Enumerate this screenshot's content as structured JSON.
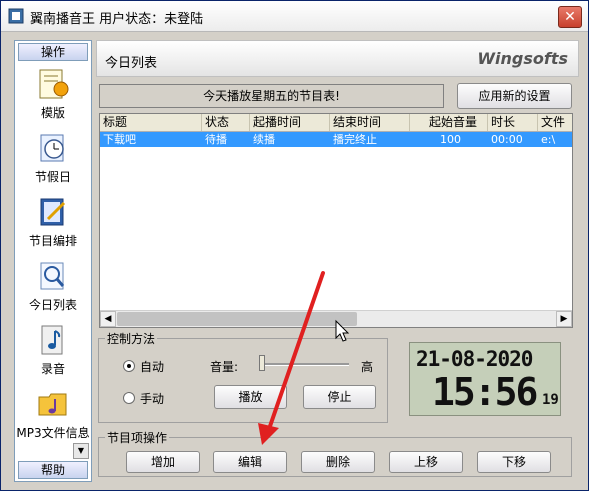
{
  "window": {
    "title": "翼南播音王  用户状态：未登陆",
    "close_glyph": "✕"
  },
  "sidebar": {
    "header": "操作",
    "items": [
      {
        "label": "模版",
        "icon": "template-icon"
      },
      {
        "label": "节假日",
        "icon": "clock-icon"
      },
      {
        "label": "节目编排",
        "icon": "schedule-edit-icon"
      },
      {
        "label": "今日列表",
        "icon": "today-list-icon"
      },
      {
        "label": "录音",
        "icon": "music-note-icon"
      },
      {
        "label": "MP3文件信息",
        "icon": "folder-music-icon"
      }
    ],
    "footer": "帮助"
  },
  "header": {
    "title": "今日列表",
    "brand": "Wingsofts"
  },
  "notice": "今天播放星期五的节目表!",
  "apply_button": "应用新的设置",
  "table": {
    "columns": [
      "标题",
      "状态",
      "起播时间",
      "结束时间",
      "起始音量",
      "时长",
      "文件"
    ],
    "rows": [
      [
        "下载吧",
        "待播",
        "续播",
        "播完终止",
        "100",
        "00:00",
        "e:\\"
      ]
    ]
  },
  "control": {
    "label": "控制方法",
    "auto_label": "自动",
    "manual_label": "手动",
    "mode_selected": "自动",
    "volume_label": "音量:",
    "volume_high": "高",
    "volume_level": 0,
    "play_button": "播放",
    "stop_button": "停止"
  },
  "clock": {
    "date": "21-08-2020",
    "time": "15:56",
    "seconds": "19"
  },
  "ops": {
    "label": "节目项操作",
    "buttons": [
      "增加",
      "编辑",
      "删除",
      "上移",
      "下移"
    ]
  },
  "colors": {
    "selection": "#3399ff",
    "annotation_arrow": "#e02020",
    "lcd_background": "#c5cfb9"
  }
}
